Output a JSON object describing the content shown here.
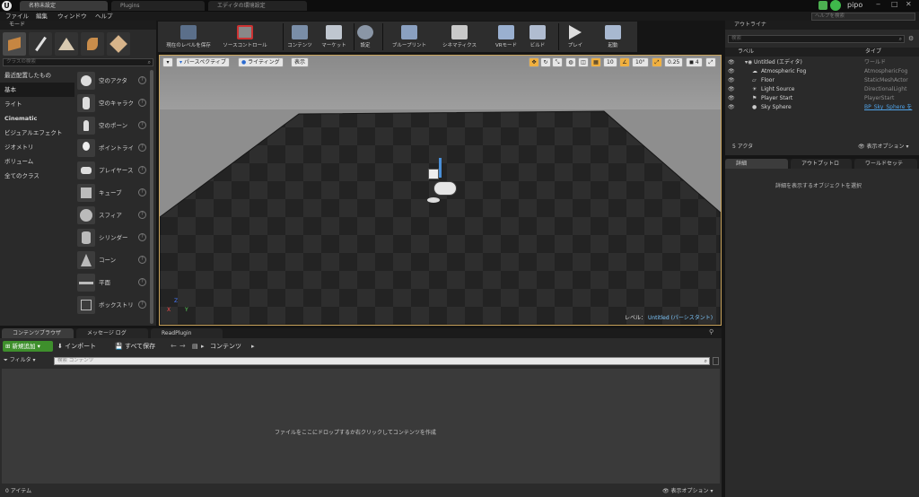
{
  "window": {
    "tabs": [
      "名称未設定",
      "Plugins",
      "エディタの環境設定"
    ],
    "help_search_placeholder": "ヘルプを検索",
    "user": "pipo",
    "controls": [
      "‒",
      "□",
      "✕"
    ]
  },
  "menu": [
    "ファイル",
    "編集",
    "ウィンドウ",
    "ヘルプ"
  ],
  "modes": {
    "title": "モード",
    "search_placeholder": "クラスの検索",
    "categories": [
      "最近配置したもの",
      "基本",
      "ライト",
      "Cinematic",
      "ビジュアルエフェクト",
      "ジオメトリ",
      "ボリューム",
      "全てのクラス"
    ],
    "selected_category": "基本",
    "items": [
      "空のアクタ",
      "空のキャラク",
      "空のポーン",
      "ポイントライ",
      "プレイヤース",
      "キューブ",
      "スフィア",
      "シリンダー",
      "コーン",
      "平面",
      "ボックストリ"
    ],
    "help_glyph": "?"
  },
  "toolbar": {
    "buttons": [
      "現在のレベルを保存",
      "ソースコントロール",
      "コンテンツ",
      "マーケット",
      "設定",
      "ブループリント",
      "シネマティクス",
      "VRモード",
      "ビルド",
      "プレイ",
      "起動"
    ]
  },
  "viewport": {
    "perspective": "パースペクティブ",
    "lighting": "ライティング",
    "show": "表示",
    "grid_snap": "10",
    "rot_snap": "10°",
    "scale_snap": "0.25",
    "cam_speed": "4",
    "level_label": "レベル：",
    "level_name": "Untitled (パーシスタント)",
    "axis_x": "X",
    "axis_y": "Y",
    "axis_z": "Z"
  },
  "outliner": {
    "title": "アウトライナ",
    "search_placeholder": "検索",
    "col_label": "ラベル",
    "col_type": "タイプ",
    "rows": [
      {
        "name": "Untitled (エディタ)",
        "type": "ワールド"
      },
      {
        "name": "Atmospheric Fog",
        "type": "AtmosphericFog"
      },
      {
        "name": "Floor",
        "type": "StaticMeshActor"
      },
      {
        "name": "Light Source",
        "type": "DirectionalLight"
      },
      {
        "name": "Player Start",
        "type": "PlayerStart"
      },
      {
        "name": "Sky Sphere",
        "type": "BP_Sky_Sphere を"
      }
    ],
    "count": "5 アクタ",
    "view_options": "表示オプション"
  },
  "details": {
    "tabs": [
      "詳細",
      "アウトプットロ",
      "ワールドセッテ"
    ],
    "empty_text": "詳細を表示するオブジェクトを選択"
  },
  "content_browser": {
    "tabs": [
      "コンテンツブラウザ",
      "メッセージ ログ",
      "ReadPlugin"
    ],
    "add_new": "新規追加",
    "import": "インポート",
    "save_all": "すべて保存",
    "path": "コンテンツ",
    "filters": "フィルタ",
    "search_placeholder": "検索 コンテンツ",
    "empty_text": "ファイルをここにドロップするか右クリックしてコンテンツを作成",
    "item_count": "0 アイテム",
    "view_options": "表示オプション"
  },
  "colors": {
    "accent_orange": "#c9a35b",
    "green_button": "#3e8f2c",
    "link_blue": "#4fa3e8",
    "viewport_sky": "#9a9a9a",
    "floor_dark": "#1f1f1f"
  }
}
